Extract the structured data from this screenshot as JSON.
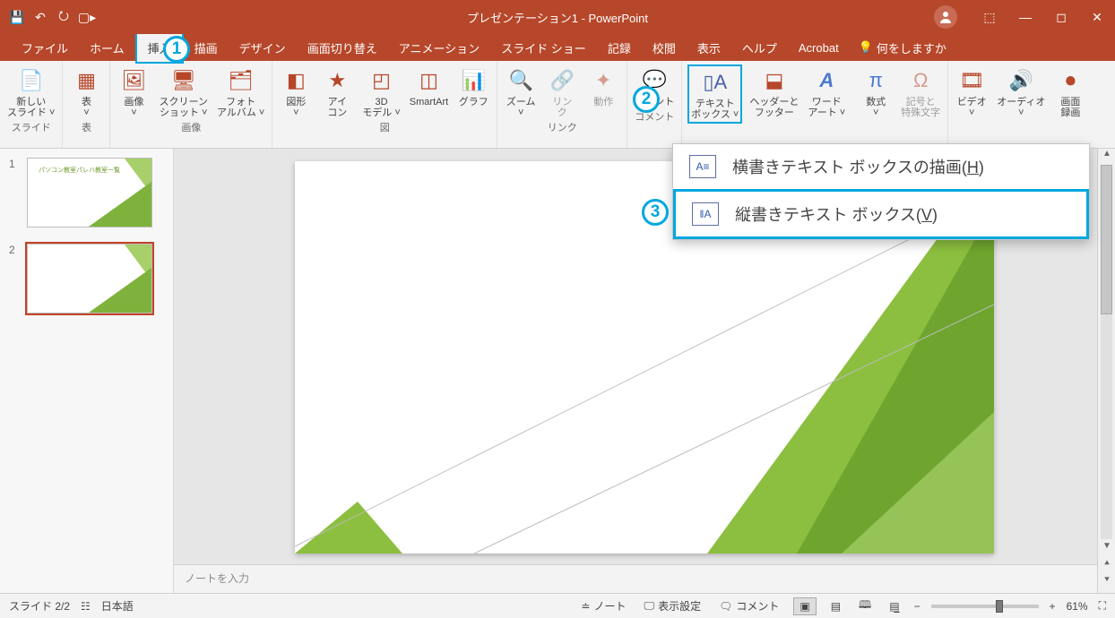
{
  "title": "プレゼンテーション1 - PowerPoint",
  "tabs": {
    "file": "ファイル",
    "home": "ホーム",
    "insert": "挿入",
    "draw": "描画",
    "design": "デザイン",
    "transition": "画面切り替え",
    "animation": "アニメーション",
    "slideshow": "スライド ショー",
    "record": "記録",
    "review": "校閲",
    "view": "表示",
    "help": "ヘルプ",
    "acrobat": "Acrobat",
    "tellme": "何をしますか"
  },
  "ribbon": {
    "newslide": "新しい\nスライド ˅",
    "table": "表\n˅",
    "image": "画像\n˅",
    "screenshot": "スクリーン\nショット ˅",
    "photoalbum": "フォト\nアルバム ˅",
    "shapes": "図形\n˅",
    "icons": "アイ\nコン",
    "model3d": "3D\nモデル ˅",
    "smartart": "SmartArt",
    "chart": "グラフ",
    "zoom": "ズーム\n˅",
    "link": "リン\nク",
    "action": "動作",
    "comment": "コメント",
    "textbox": "テキスト\nボックス ˅",
    "headerfooter": "ヘッダーと\nフッター",
    "wordart": "ワード\nアート ˅",
    "equation": "数式\n˅",
    "symbol": "記号と\n特殊文字",
    "video": "ビデオ\n˅",
    "audio": "オーディオ\n˅",
    "screenrec": "画面\n録画",
    "groups": {
      "slide": "スライド",
      "table": "表",
      "images": "画像",
      "illustrations": "図",
      "links": "リンク",
      "comment": "コメント"
    }
  },
  "dropdown": {
    "horizontal": "横書きテキスト ボックスの描画(",
    "horizontal_key": "H",
    "horizontal_end": ")",
    "vertical": "縦書きテキスト ボックス(",
    "vertical_key": "V",
    "vertical_end": ")"
  },
  "callouts": {
    "one": "1",
    "two": "2",
    "three": "3"
  },
  "thumbs": {
    "n1": "1",
    "n2": "2",
    "t1": "パソコン教室パレハ教室一覧"
  },
  "notes": "ノートを入力",
  "status": {
    "slide": "スライド 2/2",
    "lang": "日本語",
    "notes_btn": "ノート",
    "display_settings": "表示設定",
    "comment": "コメント",
    "zoom_pct": "61%"
  }
}
